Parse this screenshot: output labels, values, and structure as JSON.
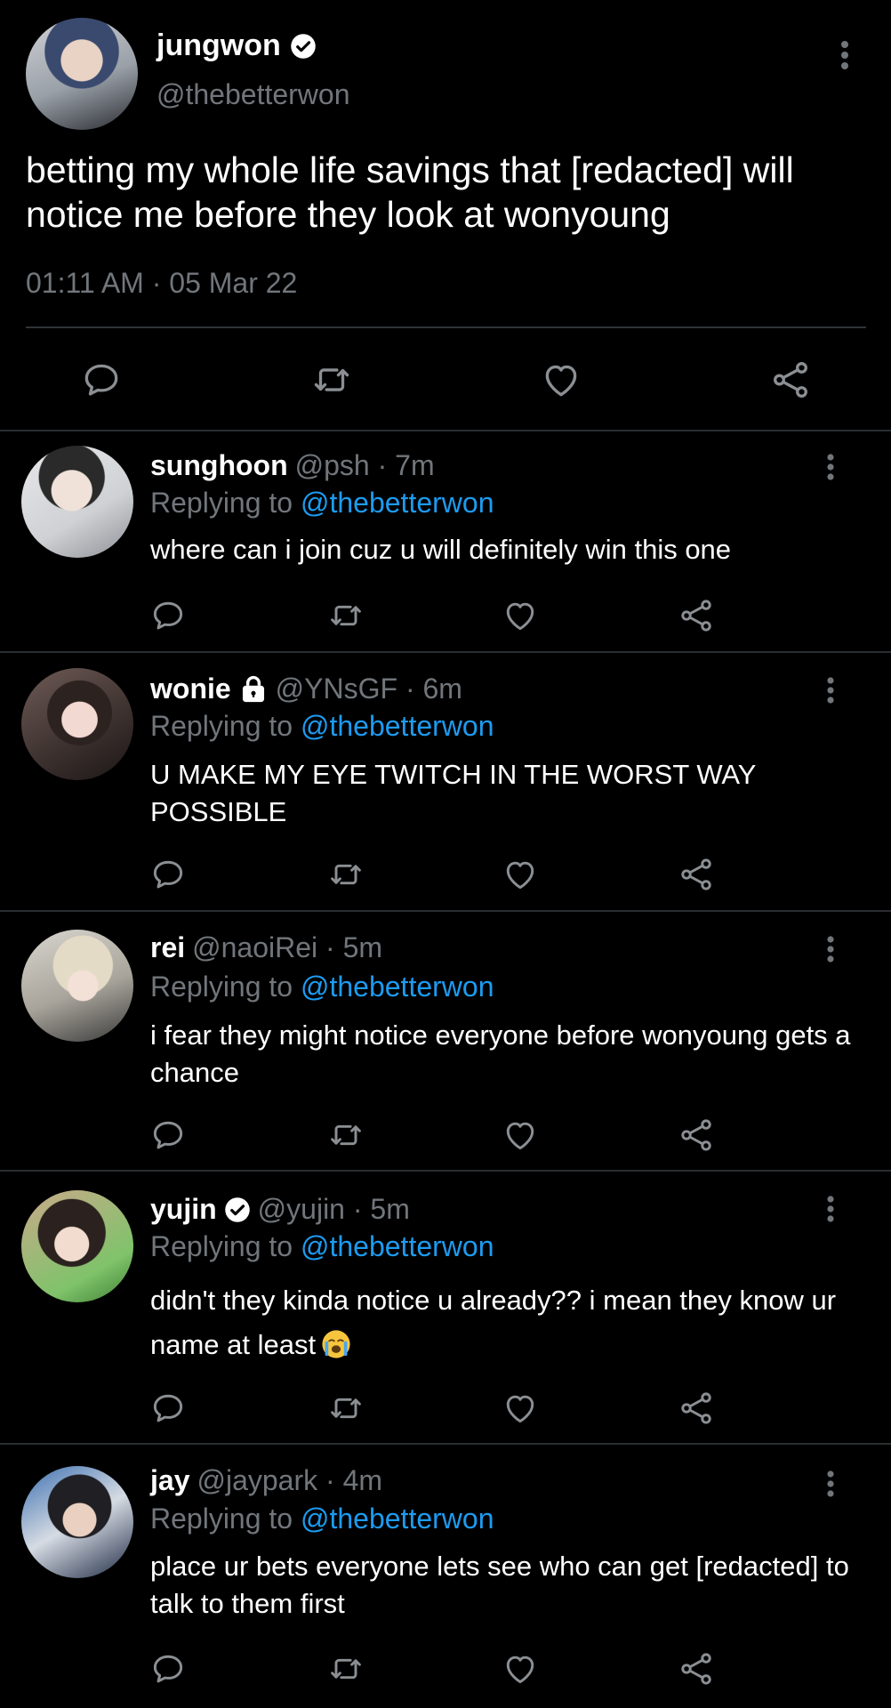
{
  "main": {
    "name": "jungwon",
    "handle": "@thebetterwon",
    "text": "betting my whole life savings that [redacted] will notice me before they look at wonyoung",
    "time": "01:11 AM · 05 Mar 22"
  },
  "colors": {
    "background": "#000000",
    "text": "#ffffff",
    "muted": "#71767b",
    "link": "#1d9bf0",
    "divider": "#2f3336"
  },
  "icons": [
    "reply-icon",
    "retweet-icon",
    "like-icon",
    "share-icon",
    "more-icon",
    "verified-icon",
    "lock-icon",
    "crying-emoji"
  ],
  "replies": [
    {
      "name": "sunghoon",
      "meta": "@psh · 7m",
      "replying_prefix": "Replying to ",
      "replying_to": "@thebetterwon",
      "text": "where can i join cuz u will definitely win this one"
    },
    {
      "name": "wonie",
      "meta": "@YNsGF · 6m",
      "replying_prefix": "Replying to ",
      "replying_to": "@thebetterwon",
      "text": "U MAKE MY EYE TWITCH IN THE WORST WAY POSSIBLE"
    },
    {
      "name": "rei",
      "meta": "@naoiRei · 5m",
      "replying_prefix": "Replying to ",
      "replying_to": "@thebetterwon",
      "text": "i fear they might notice everyone before wonyoung gets a chance"
    },
    {
      "name": "yujin",
      "meta": "@yujin · 5m",
      "replying_prefix": "Replying to ",
      "replying_to": "@thebetterwon",
      "text": "didn't they kinda notice u already?? i mean they know ur name at least"
    },
    {
      "name": "jay",
      "meta": "@jaypark · 4m",
      "replying_prefix": "Replying to ",
      "replying_to": "@thebetterwon",
      "text": "place ur bets everyone lets see who can get [redacted] to talk to them first"
    }
  ]
}
